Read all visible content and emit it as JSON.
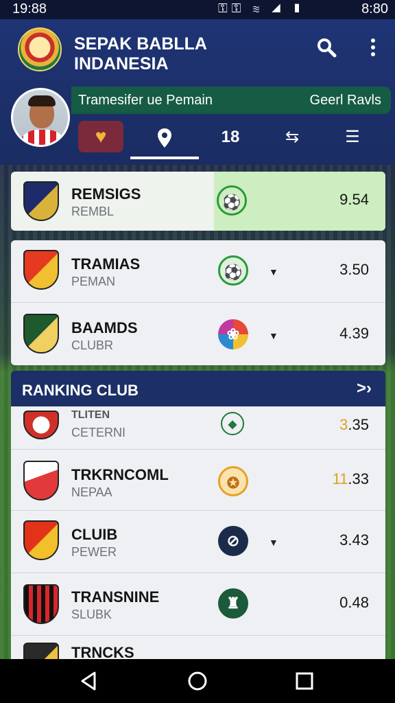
{
  "status_bar": {
    "time": "19:88",
    "icons": "⚿⚿ ≋ ◢ ▮",
    "clock": "8:80"
  },
  "header": {
    "title": "SEPAK BABLLA INDANESIA",
    "banner_left": "Tramesifer ue Pemain",
    "banner_right": "Geerl Ravls",
    "tabs": [
      "♥",
      "⬤",
      "18",
      "⇆",
      "☰"
    ]
  },
  "top_rows": [
    {
      "name": "REMSIGS",
      "sub": "REMBL",
      "value": "9.54",
      "icon_char": "⚽",
      "highlighted": true,
      "crest_colors": [
        "#1d2b6b",
        "#d8b23a"
      ]
    },
    {
      "name": "TRAMIAS",
      "sub": "PEMAN",
      "value": "3.50",
      "icon_char": "⚽",
      "crest_colors": [
        "#e63a20",
        "#f0c030"
      ]
    },
    {
      "name": "BAAMDS",
      "sub": "CLUBR",
      "value": "4.39",
      "icon_char": "❀",
      "crest_colors": [
        "#1f5a2f",
        "#f0d060"
      ]
    }
  ],
  "ranking": {
    "header": "RANKING CLUB",
    "rows": [
      {
        "name": "TLITEN",
        "sub": "CETERNI",
        "value_lead": "3",
        "value_rest": ".35",
        "icon_char": "◆",
        "crest_colors": [
          "#ffffff",
          "#d0302a"
        ]
      },
      {
        "name": "TRKRNCOML",
        "sub": "NEPAA",
        "value_lead": "11",
        "value_rest": ".33",
        "icon_char": "✪",
        "crest_colors": [
          "#e23a3a",
          "#ffffff"
        ]
      },
      {
        "name": "CLUIB",
        "sub": "PEWER",
        "value_lead": "",
        "value_rest": "3.43",
        "icon_char": "⊘",
        "crest_colors": [
          "#e2321a",
          "#f2c02a"
        ]
      },
      {
        "name": "TRANSNINE",
        "sub": "SLUBK",
        "value_lead": "",
        "value_rest": "0.48",
        "icon_char": "♜",
        "crest_colors": [
          "#111111",
          "#d8262a"
        ]
      },
      {
        "name": "TRNCKS",
        "sub": "",
        "value_lead": "",
        "value_rest": "",
        "icon_char": "",
        "crest_colors": [
          "#2a2a2a",
          "#f0c040"
        ]
      }
    ]
  }
}
